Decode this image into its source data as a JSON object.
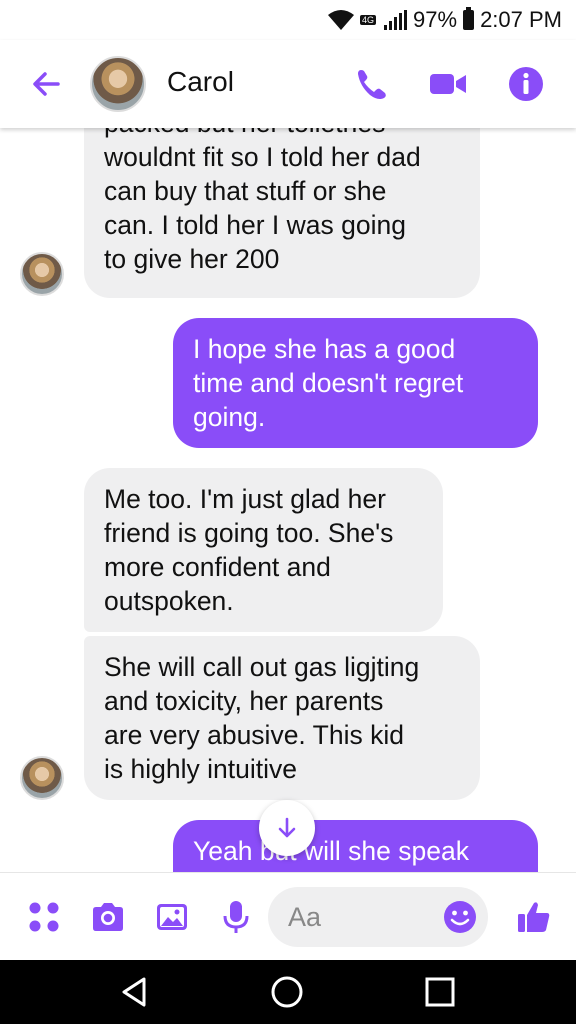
{
  "status_bar": {
    "network": "4G",
    "battery": "97%",
    "time": "2:07 PM"
  },
  "header": {
    "contact_name": "Carol",
    "icons": [
      "back-arrow-icon",
      "phone-icon",
      "video-camera-icon",
      "info-icon"
    ]
  },
  "messages": [
    {
      "direction": "in",
      "text": "packed but her toiletries\nwouldnt fit so I told her dad\ncan buy that stuff or she\ncan. I told her I was going\nto give her 200"
    },
    {
      "direction": "out",
      "text": "I hope she has a good\ntime and doesn't regret\ngoing."
    },
    {
      "direction": "in",
      "text": "Me too. I'm just glad her\nfriend is going too. She's\nmore confident and\noutspoken."
    },
    {
      "direction": "in",
      "text": "She will call out gas ligjting\nand toxicity, her parents\nare very abusive. This kid\nis highly intuitive"
    },
    {
      "direction": "out",
      "text": "Yeah but will she speak"
    }
  ],
  "composer": {
    "placeholder": "Aa",
    "icons": [
      "apps-icon",
      "camera-icon",
      "gallery-icon",
      "microphone-icon",
      "emoji-icon",
      "thumbs-up-icon"
    ]
  },
  "colors": {
    "accent": "#8a4df8",
    "incoming_bubble": "#efeff0"
  }
}
